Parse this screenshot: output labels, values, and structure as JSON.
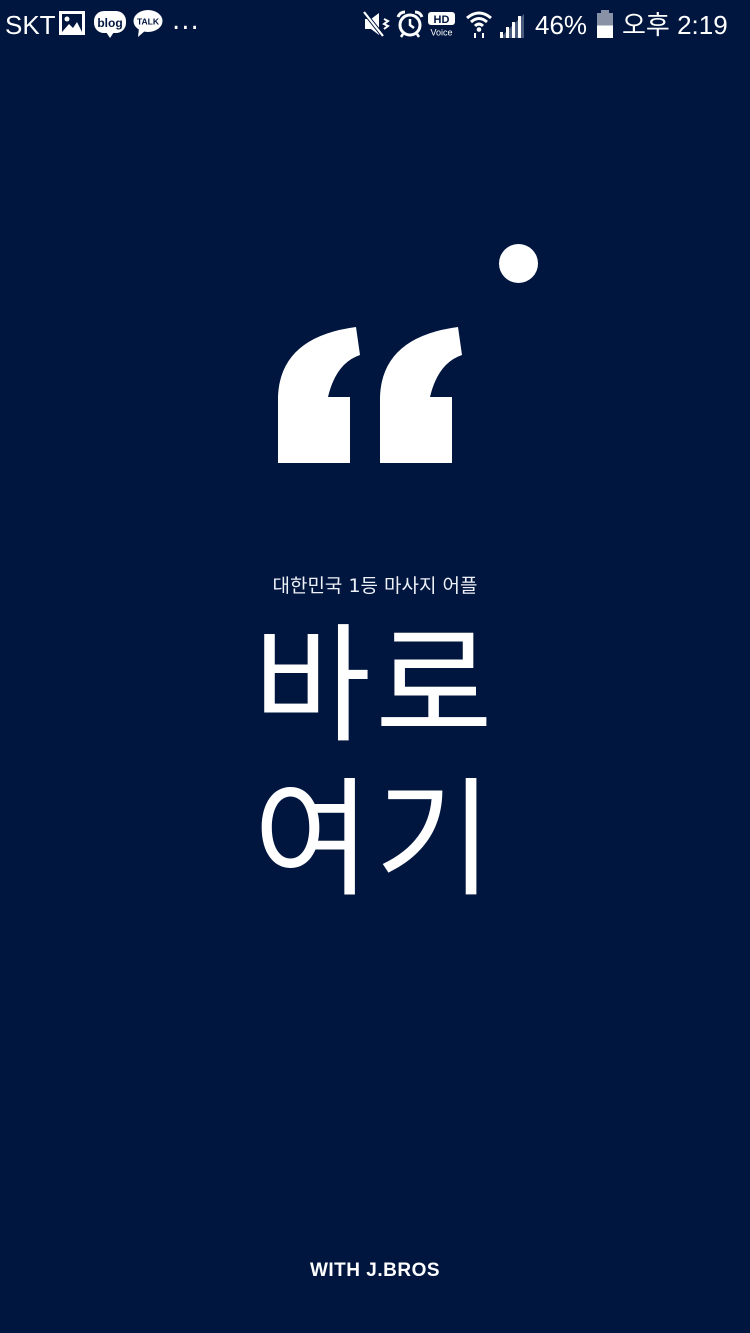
{
  "status_bar": {
    "carrier": "SKT",
    "notification_icons": [
      "gallery-icon",
      "blog-icon",
      "kakaotalk-icon"
    ],
    "blog_icon_text": "blog",
    "talk_icon_text": "TALK",
    "more_notifications": "...",
    "hd_voice_top": "HD",
    "hd_voice_bottom": "Voice",
    "system_icons": [
      "mute-icon",
      "alarm-icon",
      "hd-voice-icon",
      "wifi-icon",
      "signal-icon",
      "battery-icon"
    ],
    "battery_percent": "46%",
    "time": "오후 2:19"
  },
  "splash": {
    "tagline": "대한민국 1등 마사지 어플",
    "title_line1": "바로",
    "title_line2": "여기",
    "footer": "WITH J.BROS",
    "decorations": [
      "quote-mark-icon",
      "dot"
    ]
  },
  "colors": {
    "background": "#01163f",
    "text": "#ffffff"
  }
}
